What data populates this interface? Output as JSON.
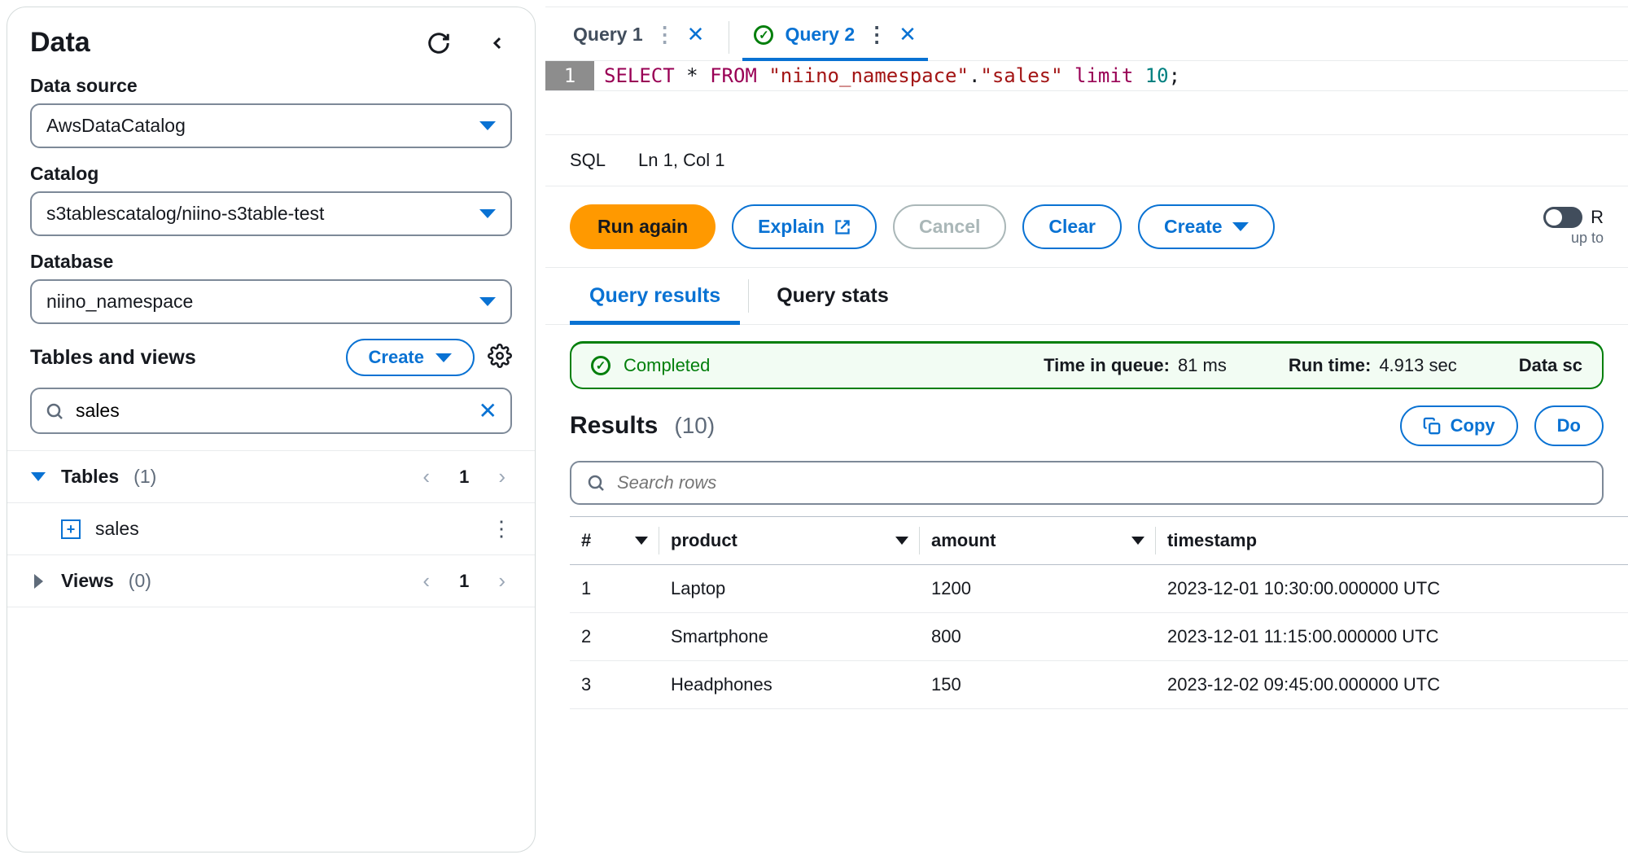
{
  "sidebar": {
    "title": "Data",
    "data_source_label": "Data source",
    "data_source_value": "AwsDataCatalog",
    "catalog_label": "Catalog",
    "catalog_value": "s3tablescatalog/niino-s3table-test",
    "database_label": "Database",
    "database_value": "niino_namespace",
    "tv_title": "Tables and views",
    "create_label": "Create",
    "search_value": "sales",
    "tables_label": "Tables",
    "tables_count": "(1)",
    "tables_page": "1",
    "table_item": "sales",
    "views_label": "Views",
    "views_count": "(0)",
    "views_page": "1"
  },
  "tabs": {
    "t1": "Query 1",
    "t2": "Query 2"
  },
  "editor": {
    "lineno": "1",
    "code_html": "SELECT * FROM \"niino_namespace\".\"sales\" limit 10;",
    "lang": "SQL",
    "pos": "Ln 1, Col 1"
  },
  "actions": {
    "run": "Run again",
    "explain": "Explain",
    "cancel": "Cancel",
    "clear": "Clear",
    "create": "Create",
    "toggle_r": "R",
    "toggle_sub": "up to"
  },
  "results": {
    "tab_results": "Query results",
    "tab_stats": "Query stats",
    "status": "Completed",
    "tiq_k": "Time in queue:",
    "tiq_v": "81 ms",
    "rt_k": "Run time:",
    "rt_v": "4.913 sec",
    "ds_k": "Data sc",
    "title": "Results",
    "count": "(10)",
    "copy": "Copy",
    "dl": "Do",
    "search_placeholder": "Search rows",
    "cols": {
      "c0": "#",
      "c1": "product",
      "c2": "amount",
      "c3": "timestamp"
    },
    "rows": [
      {
        "c0": "1",
        "c1": "Laptop",
        "c2": "1200",
        "c3": "2023-12-01 10:30:00.000000 UTC"
      },
      {
        "c0": "2",
        "c1": "Smartphone",
        "c2": "800",
        "c3": "2023-12-01 11:15:00.000000 UTC"
      },
      {
        "c0": "3",
        "c1": "Headphones",
        "c2": "150",
        "c3": "2023-12-02 09:45:00.000000 UTC"
      }
    ]
  }
}
